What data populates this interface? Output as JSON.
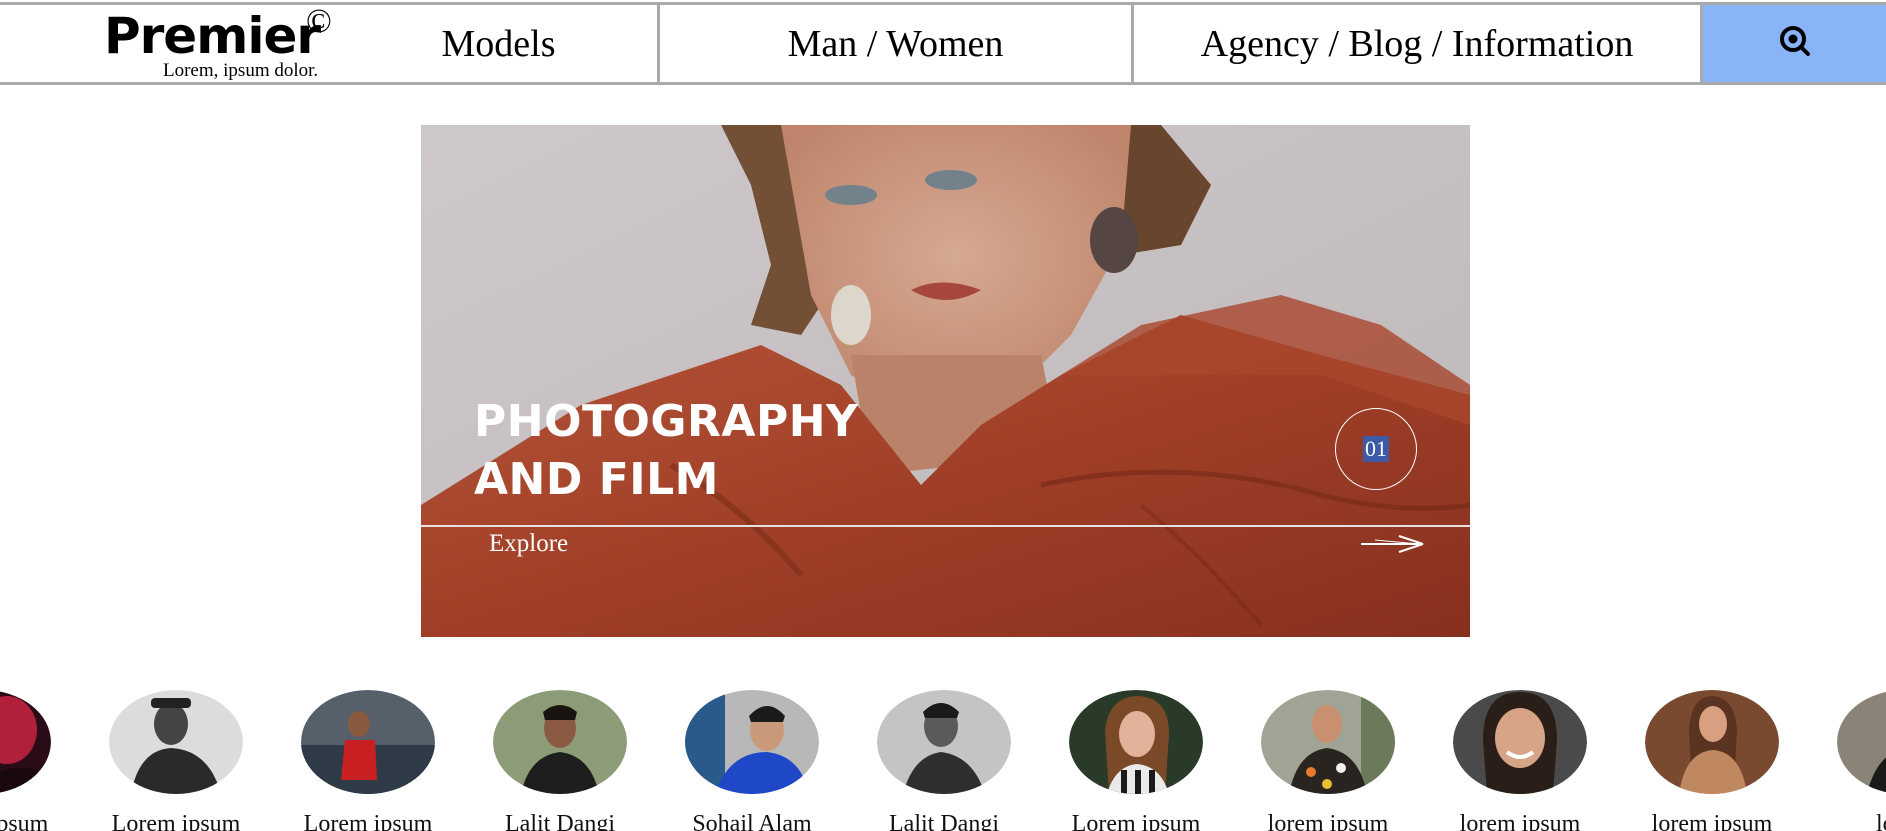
{
  "header": {
    "brand": "Premier",
    "brand_mark": "©",
    "tagline": "Lorem, ipsum dolor.",
    "nav": [
      "Models",
      "Man / Women",
      "Agency / Blog / Information"
    ],
    "search_icon": "search-eye-icon",
    "search_bg": "#8ab4f8"
  },
  "hero": {
    "title_line1": "PHOTOGRAPHY",
    "title_line2": "AND FILM",
    "counter": "01",
    "explore": "Explore",
    "arrow_icon": "arrow-right-icon"
  },
  "models": [
    {
      "name": "Lorem ipsum",
      "photo_tone": "#3a1020"
    },
    {
      "name": "Lorem ipsum",
      "photo_tone": "#d8d8d8"
    },
    {
      "name": "Lorem ipsum",
      "photo_tone": "#5a6068"
    },
    {
      "name": "Lalit Dangi",
      "photo_tone": "#8a9a70"
    },
    {
      "name": "Sohail Alam",
      "photo_tone": "#2a4aa8"
    },
    {
      "name": "Lalit Dangi",
      "photo_tone": "#a8a8a8"
    },
    {
      "name": "Lorem ipsum",
      "photo_tone": "#4a3a2a"
    },
    {
      "name": "lorem ipsum",
      "photo_tone": "#9aa090"
    },
    {
      "name": "lorem ipsum",
      "photo_tone": "#5a4a40"
    },
    {
      "name": "lorem ipsum",
      "photo_tone": "#8a5a3a"
    },
    {
      "name": "lorem",
      "photo_tone": "#6a6660"
    }
  ]
}
